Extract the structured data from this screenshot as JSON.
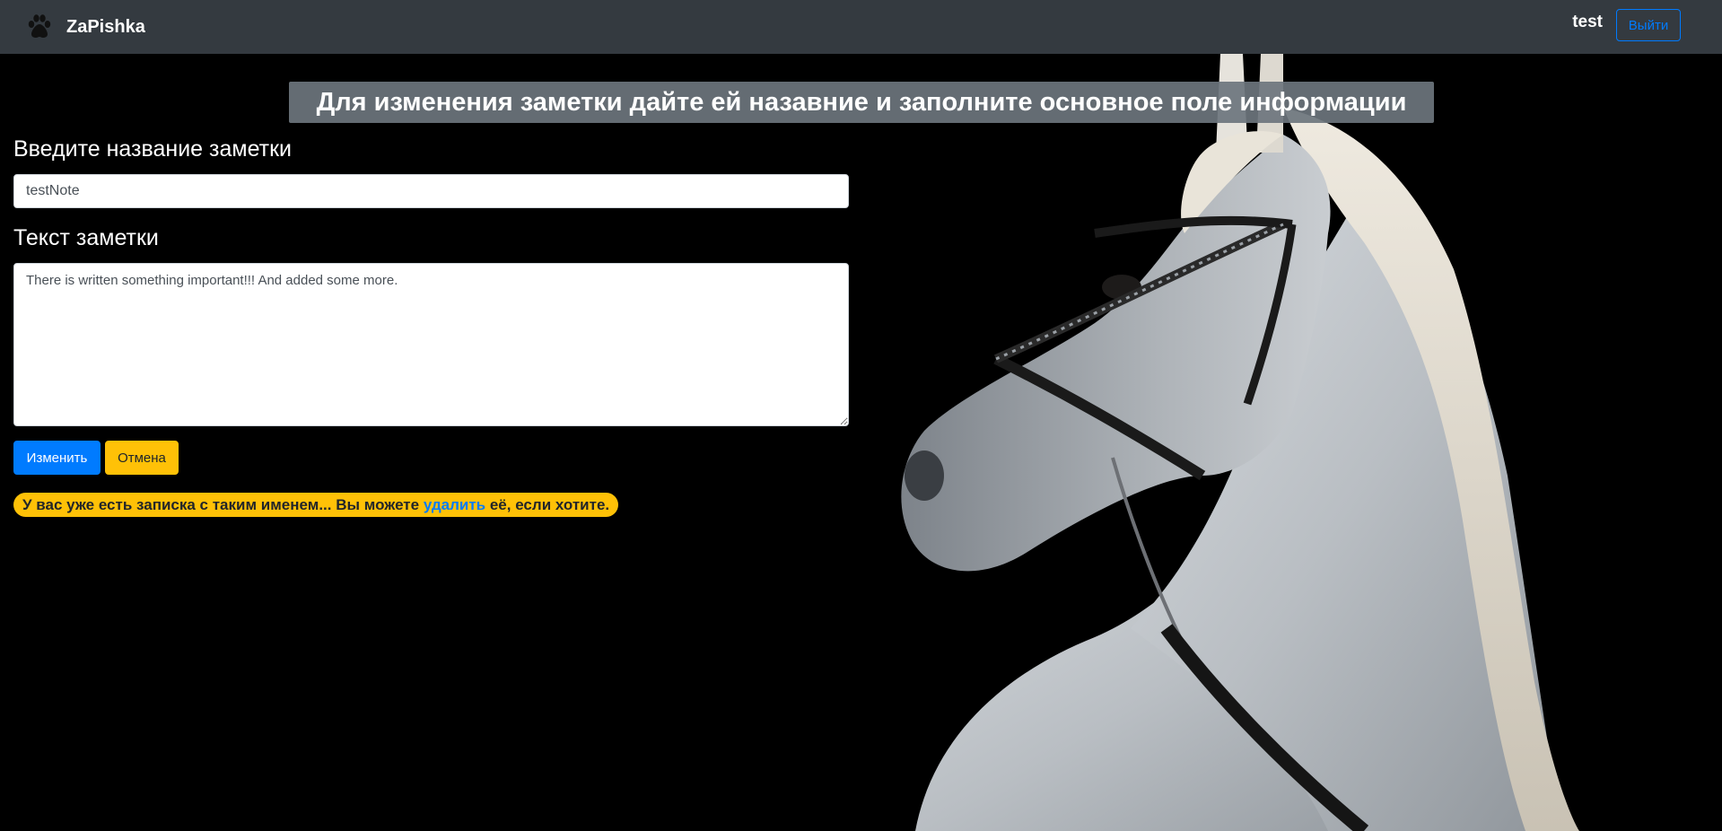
{
  "navbar": {
    "brand": "ZaPishka",
    "brand_icon": "paw-icon",
    "user": "test",
    "logout_label": "Выйти"
  },
  "main": {
    "heading": "Для изменения заметки дайте ей назавние и заполните основное поле информации",
    "title_label": "Введите название заметки",
    "title_value": "testNote",
    "text_label": "Текст заметки",
    "text_value": "There is written something important!!! And added some more.",
    "submit_label": "Изменить",
    "cancel_label": "Отмена"
  },
  "alert": {
    "text_before": "У вас уже есть записка с таким именем... Вы можете ",
    "link_text": "удалить",
    "text_after": " её, если хотите."
  },
  "colors": {
    "navbar_bg": "#343a40",
    "primary": "#007bff",
    "warning": "#ffc107",
    "heading_bg": "#6c757d"
  }
}
